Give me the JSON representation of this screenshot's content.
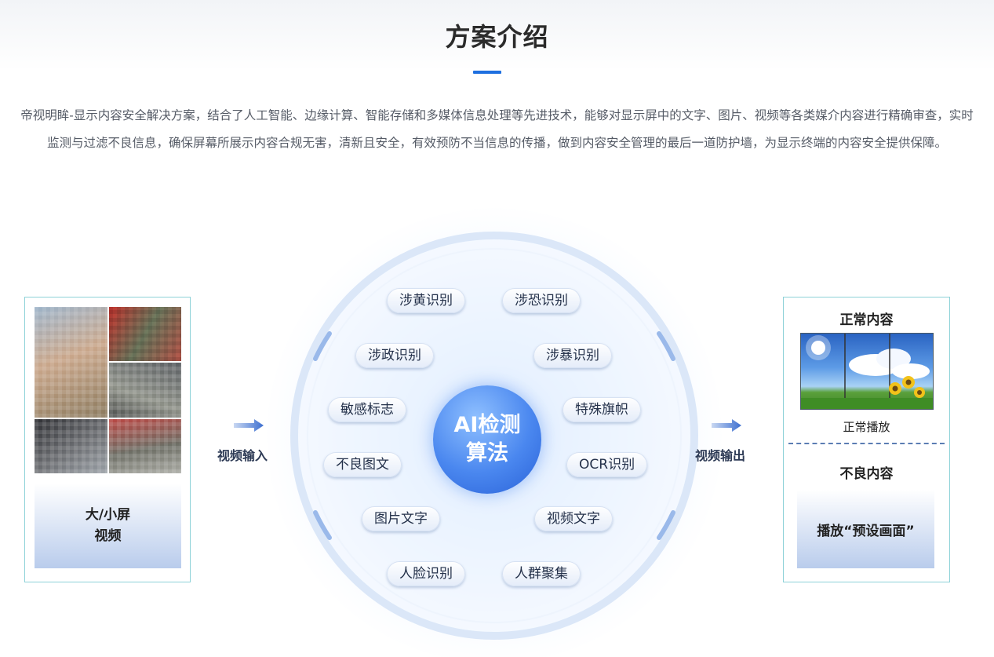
{
  "header": {
    "title": "方案介绍",
    "accent_color": "#1e6fe0",
    "intro": "帝视明眸-显示内容安全解决方案，结合了人工智能、边缘计算、智能存储和多媒体信息处理等先进技术，能够对显示屏中的文字、图片、视频等各类媒介内容进行精确审查，实时监测与过滤不良信息，确保屏幕所展示内容合规无害，清新且安全，有效预防不当信息的传播，做到内容安全管理的最后一道防护墙，为显示终端的内容安全提供保障。"
  },
  "input": {
    "label_line1": "大/小屏",
    "label_line2": "视频",
    "flow_label": "视频输入"
  },
  "algorithm": {
    "core_line1": "AI检测",
    "core_line2": "算法",
    "modules": [
      "涉黄识别",
      "涉恐识别",
      "涉政识别",
      "涉暴识别",
      "敏感标志",
      "特殊旗帜",
      "不良图文",
      "OCR识别",
      "图片文字",
      "视频文字",
      "人脸识别",
      "人群聚集"
    ]
  },
  "output": {
    "flow_label": "视频输出",
    "normal_title": "正常内容",
    "normal_caption": "正常播放",
    "bad_title": "不良内容",
    "bad_action": "播放“预设画面”"
  }
}
